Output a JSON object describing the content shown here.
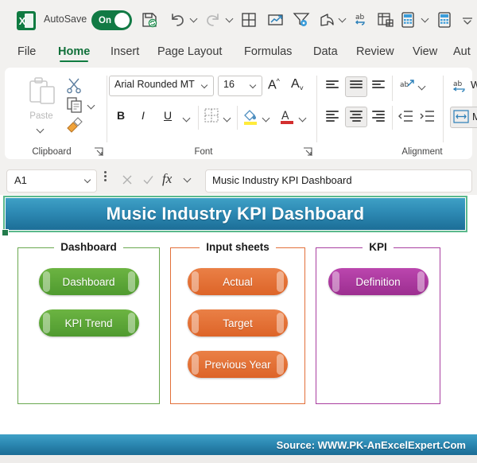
{
  "titlebar": {
    "logo_text": "X",
    "logo_icon": "excel-logo-icon",
    "autosave_label": "AutoSave",
    "autosave_state": "On",
    "quick_access": [
      {
        "name": "save-icon",
        "label": "Save"
      },
      {
        "name": "undo-icon",
        "label": "Undo"
      },
      {
        "name": "undo-dropdown-chevron-icon",
        "label": "Undo options"
      },
      {
        "name": "redo-icon",
        "label": "Redo"
      },
      {
        "name": "redo-dropdown-chevron-icon",
        "label": "Redo options"
      },
      {
        "name": "borders-icon",
        "label": "Borders"
      },
      {
        "name": "insert-chart-icon",
        "label": "Insert Chart"
      },
      {
        "name": "filter-settings-icon",
        "label": "Custom Sort and Filter"
      },
      {
        "name": "share-icon",
        "label": "Share"
      },
      {
        "name": "share-dropdown-chevron-icon",
        "label": "Share options"
      },
      {
        "name": "spelling-icon",
        "label": "Spelling"
      },
      {
        "name": "table-icon",
        "label": "Format as Table"
      },
      {
        "name": "calculate-icon",
        "label": "Calculate Now"
      },
      {
        "name": "calculate-dropdown-chevron-icon",
        "label": "Calculate options"
      },
      {
        "name": "calculate-sheet-icon",
        "label": "Calculate Sheet"
      },
      {
        "name": "customize-quick-access-toolbar-icon",
        "label": "Customize Quick Access Toolbar"
      }
    ]
  },
  "ribbon": {
    "tabs": [
      {
        "label": "File",
        "active": false
      },
      {
        "label": "Home",
        "active": true
      },
      {
        "label": "Insert",
        "active": false
      },
      {
        "label": "Page Layout",
        "active": false
      },
      {
        "label": "Formulas",
        "active": false
      },
      {
        "label": "Data",
        "active": false
      },
      {
        "label": "Review",
        "active": false
      },
      {
        "label": "View",
        "active": false
      },
      {
        "label": "Aut",
        "active": false
      }
    ],
    "groups": {
      "clipboard": {
        "label": "Clipboard",
        "paste_label": "Paste",
        "items": [
          "cut-icon",
          "copy-icon",
          "format-painter-icon"
        ]
      },
      "font": {
        "label": "Font",
        "font_name": "Arial Rounded MT",
        "font_size": "16",
        "increase_size": "A",
        "decrease_size": "A",
        "bold": "B",
        "italic": "I",
        "underline": "U"
      },
      "alignment": {
        "label": "Alignment",
        "wrap_text": "W",
        "merge_center": "M"
      }
    }
  },
  "formula_bar": {
    "name_box": "A1",
    "cancel_icon": "cancel-icon",
    "enter_icon": "enter-icon",
    "function_icon": "insert-function-icon",
    "content": "Music Industry KPI Dashboard"
  },
  "sheet": {
    "title_banner": "Music Industry KPI Dashboard",
    "source_text": "Source: WWW.PK-AnExcelExpert.Com",
    "groups": [
      {
        "title": "Dashboard",
        "color": "#6aa84f",
        "buttons": [
          {
            "label": "Dashboard"
          },
          {
            "label": "KPI Trend"
          }
        ]
      },
      {
        "title": "Input sheets",
        "color": "#e2703a",
        "buttons": [
          {
            "label": "Actual"
          },
          {
            "label": "Target"
          },
          {
            "label": "Previous Year"
          }
        ]
      },
      {
        "title": "KPI",
        "color": "#a93fa0",
        "buttons": [
          {
            "label": "Definition"
          }
        ]
      }
    ]
  },
  "colors": {
    "banner_top": "#3fa0c6",
    "banner_bottom": "#1c6e97",
    "green_button": "#56a game",
    "accent_green": "#107c41"
  }
}
